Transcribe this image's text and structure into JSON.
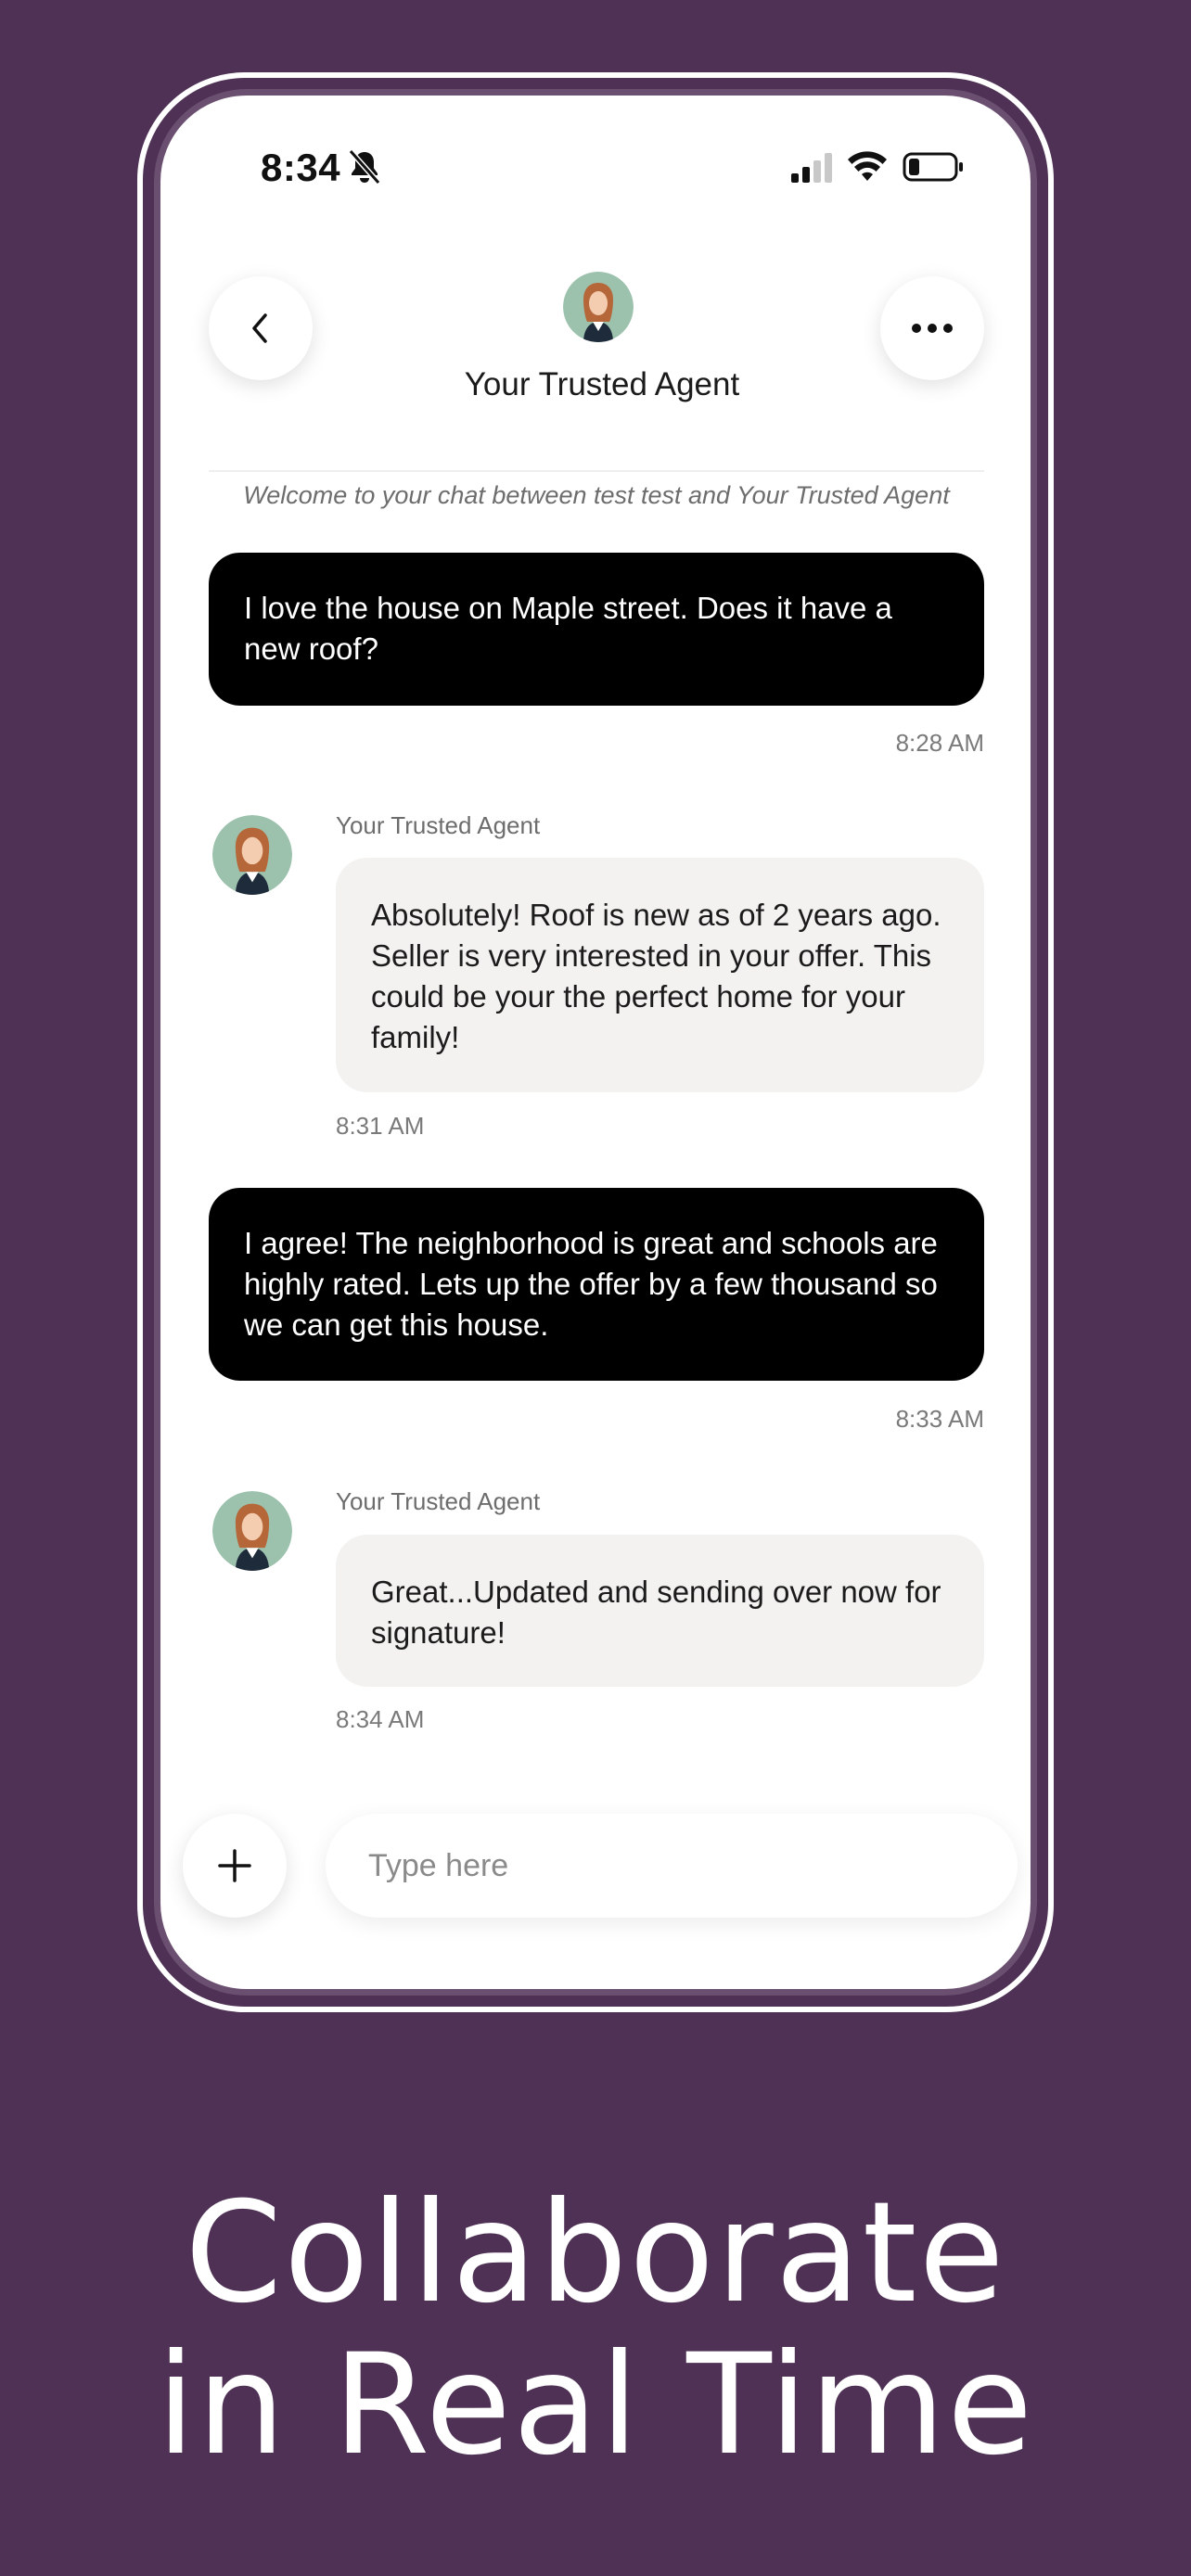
{
  "status_bar": {
    "time": "8:34"
  },
  "header": {
    "title": "Your Trusted Agent"
  },
  "welcome_text": "Welcome to your chat between test test and Your Trusted Agent",
  "messages": [
    {
      "sender": "me",
      "text": "I love the house on Maple street. Does it have a new roof?",
      "time": "8:28 AM"
    },
    {
      "sender": "agent",
      "name": "Your Trusted Agent",
      "text": "Absolutely! Roof is new as of 2 years ago. Seller is very interested in your offer. This could be your the perfect home for your family!",
      "time": "8:31 AM"
    },
    {
      "sender": "me",
      "text": "I agree! The neighborhood is great and schools are highly rated. Lets up the offer by a few thousand so we can get this house.",
      "time": "8:33 AM"
    },
    {
      "sender": "agent",
      "name": "Your Trusted Agent",
      "text": "Great...Updated and sending over now for signature!",
      "time": "8:34 AM"
    }
  ],
  "composer": {
    "placeholder": "Type here"
  },
  "marketing": {
    "line1": "Collaborate",
    "line2": "in Real Time"
  },
  "colors": {
    "background": "#4e3155",
    "sent_bubble": "#000000",
    "received_bubble": "#f3f2f0"
  },
  "icons": [
    "bell-slash-icon",
    "cellular-signal-icon",
    "wifi-icon",
    "battery-icon",
    "back-chevron-icon",
    "more-dots-icon",
    "plus-icon"
  ]
}
